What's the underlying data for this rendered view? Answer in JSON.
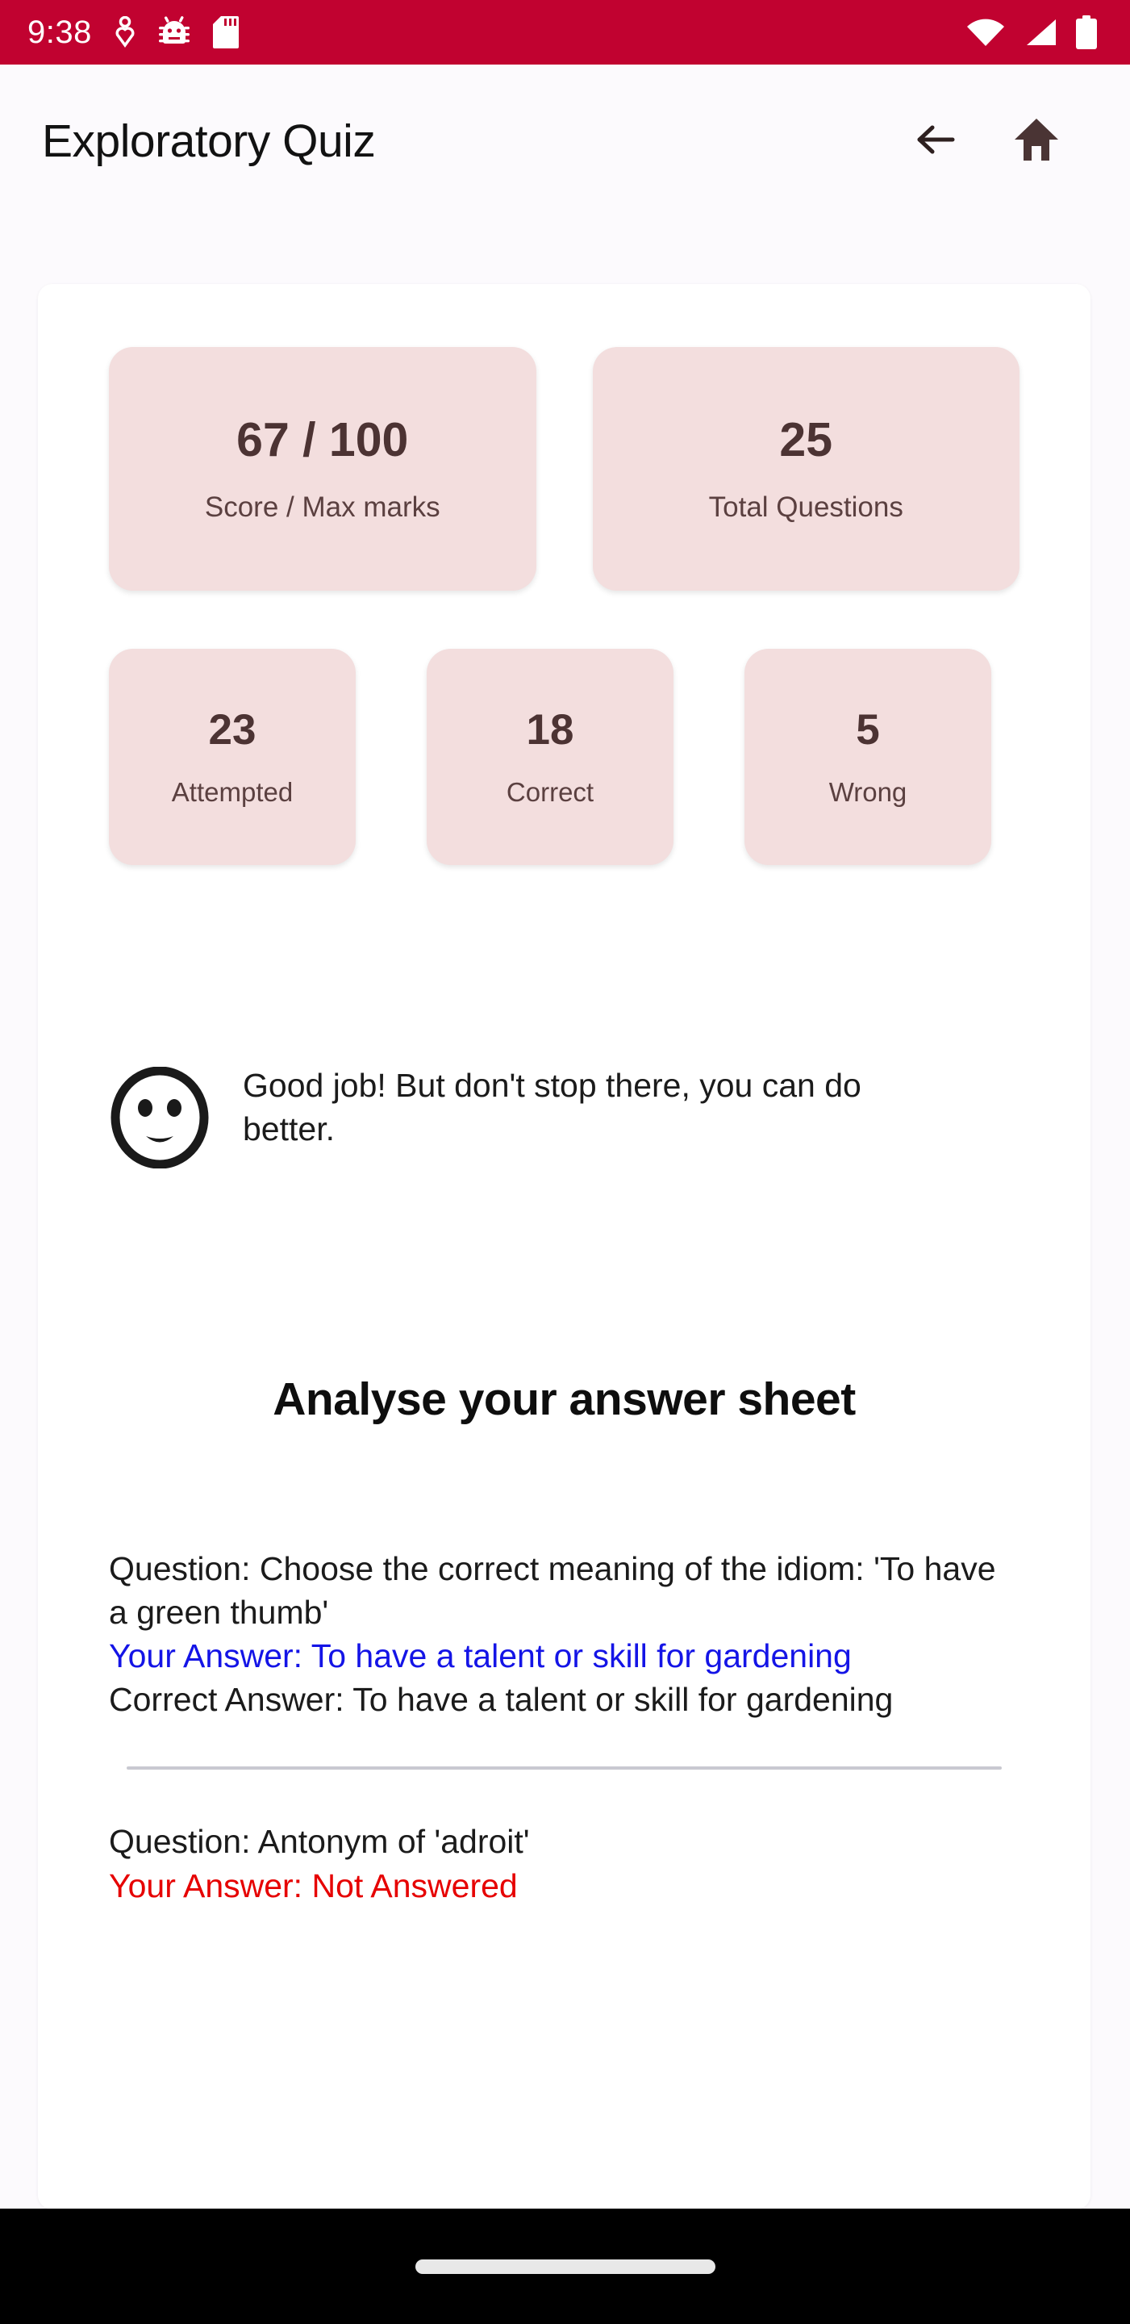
{
  "status_bar": {
    "clock": "9:38",
    "left_icons": [
      "heart-pin-icon",
      "bug-icon",
      "sd-card-icon"
    ],
    "right_icons": [
      "wifi-icon",
      "cellular-signal-icon",
      "battery-icon"
    ],
    "background_color": "#C10230"
  },
  "app_bar": {
    "title": "Exploratory Quiz",
    "back_icon": "back-arrow-icon",
    "home_icon": "home-icon"
  },
  "stats": {
    "primary": [
      {
        "value": "67 / 100",
        "label": "Score / Max marks"
      },
      {
        "value": "25",
        "label": "Total Questions"
      }
    ],
    "secondary": [
      {
        "value": "23",
        "label": "Attempted"
      },
      {
        "value": "18",
        "label": "Correct"
      },
      {
        "value": "5",
        "label": "Wrong"
      }
    ],
    "card_color": "#F3DEDE",
    "text_color": "#4C3333"
  },
  "feedback": {
    "icon": "neutral-face-icon",
    "message": "Good job! But don't stop there, you can do better."
  },
  "answer_sheet": {
    "heading": "Analyse your answer sheet",
    "labels": {
      "question_prefix": "Question: ",
      "your_answer_prefix": "Your Answer: ",
      "correct_answer_prefix": "Correct Answer: "
    },
    "items": [
      {
        "question": "Choose the correct meaning of the idiom: 'To have a green thumb'",
        "your_answer": "To have a talent or skill for gardening",
        "correct_answer": "To have a talent or skill for gardening",
        "your_answer_color": "#1414E6"
      },
      {
        "question": "Antonym of 'adroit'",
        "your_answer": "Not Answered",
        "correct_answer": "",
        "your_answer_color": "#E60000"
      }
    ]
  },
  "nav_bar": {
    "home_pill": "home-gesture-pill"
  }
}
